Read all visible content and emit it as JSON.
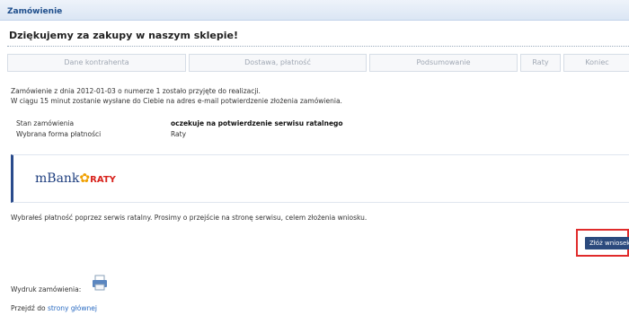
{
  "window": {
    "title": "Zamówienie"
  },
  "heading": "Dziękujemy za zakupy w naszym sklepie!",
  "steps": [
    "Dane kontrahenta",
    "Dostawa, płatność",
    "Podsumowanie",
    "Raty",
    "Koniec"
  ],
  "message": {
    "line1": "Zamówienie z dnia 2012-01-03 o numerze 1 zostało przyjęte do realizacji.",
    "line2": "W ciągu 15 minut zostanie wysłane do Ciebie na adres e-mail potwierdzenie złożenia zamówienia."
  },
  "details": {
    "status_label": "Stan zamówienia",
    "status_value": "oczekuje na potwierdzenie serwisu ratalnego",
    "payment_label": "Wybrana forma płatności",
    "payment_value": "Raty"
  },
  "bank": {
    "logo_text": "mBank",
    "logo_suffix": "RATY"
  },
  "info": "Wybrałeś płatność poprzez serwis ratalny. Prosimy o przejście na stronę serwisu, celem złożenia wniosku.",
  "submit_button": "Złóż wniosek",
  "print": {
    "label": "Wydruk zamówienia:",
    "icon": "printer-icon"
  },
  "goto": {
    "prefix": "Przejdź do",
    "link": "strony głównej"
  },
  "colors": {
    "accent": "#2b4a7d",
    "highlight": "#e02b2b",
    "link": "#2a6bc2"
  }
}
